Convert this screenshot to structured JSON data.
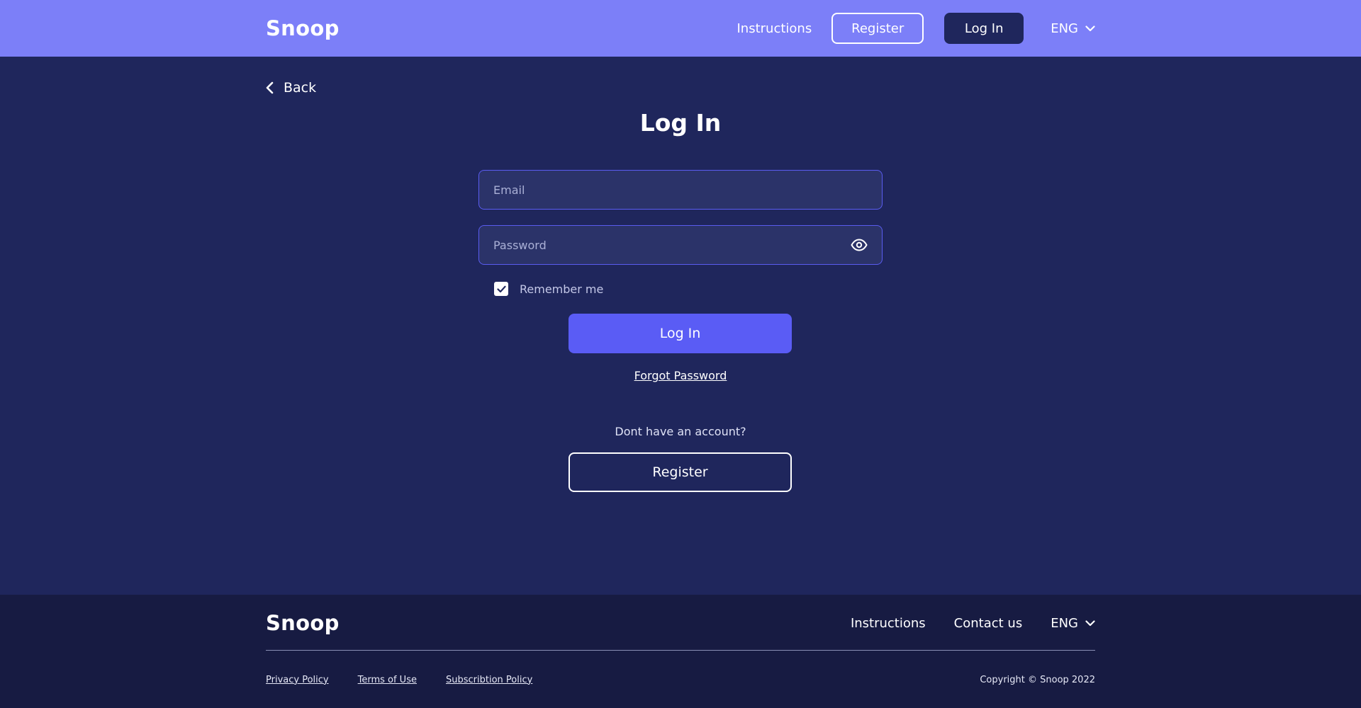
{
  "header": {
    "logo": "Snoop",
    "instructions_link": "Instructions",
    "register_button": "Register",
    "login_button": "Log In",
    "language": "ENG"
  },
  "back": {
    "label": "Back"
  },
  "login": {
    "title": "Log In",
    "email_placeholder": "Email",
    "password_placeholder": "Password",
    "remember_me_label": "Remember me",
    "remember_me_checked": true,
    "submit_label": "Log In",
    "forgot_password_label": "Forgot Password",
    "no_account_text": "Dont have an account?",
    "register_label": "Register"
  },
  "footer": {
    "logo": "Snoop",
    "instructions_link": "Instructions",
    "contact_link": "Contact us",
    "language": "ENG",
    "privacy_policy": "Privacy Policy",
    "terms_of_use": "Terms of Use",
    "subscription_policy": "Subscribtion Policy",
    "copyright": "Copyright © Snoop 2022"
  },
  "colors": {
    "header_bg": "#7c7ff8",
    "page_bg": "#1f265c",
    "footer_bg": "#171b42",
    "primary_button": "#5a5cf5",
    "input_bg": "#2b3369",
    "input_border": "#5a5cf0"
  },
  "icons": {
    "back": "chevron-left-icon",
    "language_dropdown": "chevron-down-icon",
    "password_toggle": "eye-icon",
    "checkbox": "check-icon"
  }
}
